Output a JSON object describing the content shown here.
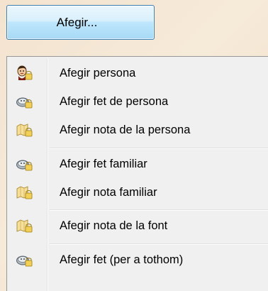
{
  "add_button": {
    "label": "Afegir..."
  },
  "menu": {
    "items": [
      {
        "label": "Afegir persona",
        "icon": "person-icon"
      },
      {
        "label": "Afegir fet de persona",
        "icon": "event-icon"
      },
      {
        "label": "Afegir nota de la persona",
        "icon": "note-icon"
      },
      {
        "label": "Afegir fet familiar",
        "icon": "event-icon"
      },
      {
        "label": "Afegir nota familiar",
        "icon": "note-icon"
      },
      {
        "label": "Afegir nota de la font",
        "icon": "note-icon"
      },
      {
        "label": "Afegir fet (per a tothom)",
        "icon": "event-icon"
      }
    ]
  },
  "colors": {
    "button_border": "#3c7fb1",
    "menu_background": "#f0f0f0"
  }
}
